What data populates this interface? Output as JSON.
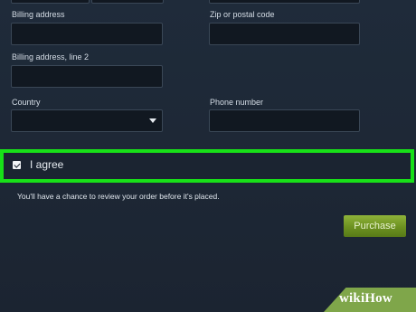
{
  "form": {
    "billing_address_label": "Billing address",
    "zip_label": "Zip or postal code",
    "billing_address_2_label": "Billing address, line 2",
    "country_label": "Country",
    "phone_label": "Phone number"
  },
  "agree": {
    "label": "I agree",
    "checked": true,
    "highlight_color": "#18e018"
  },
  "review_note": "You'll have a chance to review your order before it's placed.",
  "purchase_button": "Purchase",
  "watermark": "wikiHow"
}
